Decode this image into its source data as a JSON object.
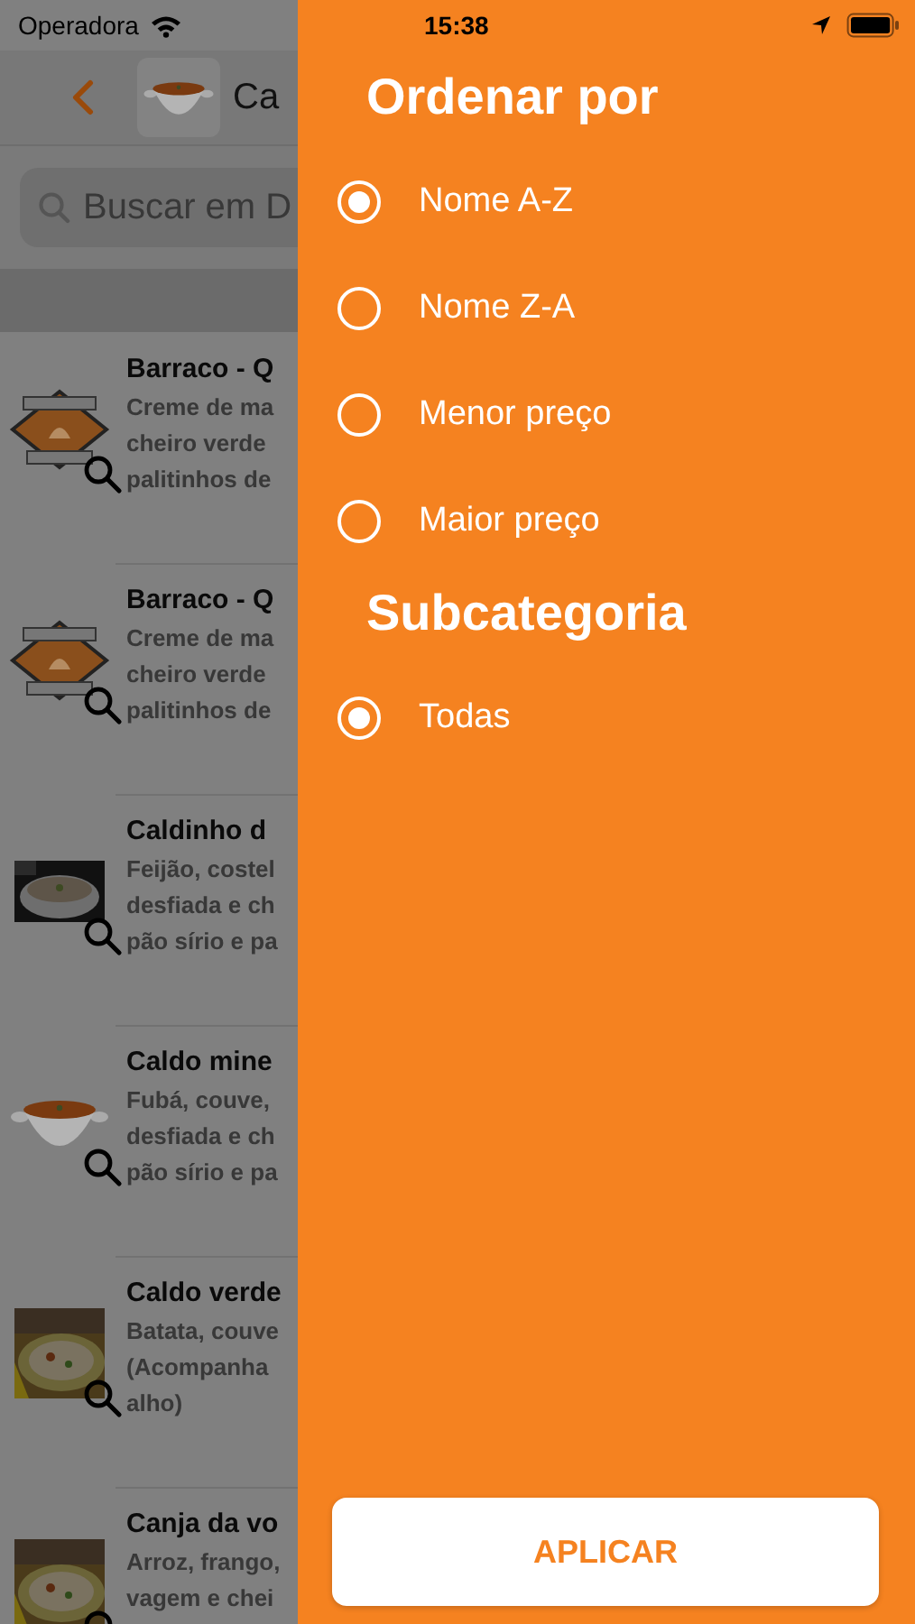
{
  "status_bar": {
    "carrier": "Operadora",
    "time": "15:38"
  },
  "nav_bar": {
    "title": "Ca"
  },
  "search": {
    "placeholder": "Buscar em D"
  },
  "dishes": [
    {
      "name": "Barraco - Q",
      "kind": "logo",
      "description_lines": [
        "Creme de ma",
        "cheiro verde",
        "palitinhos de"
      ]
    },
    {
      "name": "Barraco - Q",
      "kind": "logo",
      "description_lines": [
        "Creme de ma",
        "cheiro verde",
        "palitinhos de"
      ]
    },
    {
      "name": "Caldinho d",
      "kind": "bowl-photo",
      "description_lines": [
        "Feijão, costel",
        "desfiada e ch",
        "pão sírio e pa"
      ]
    },
    {
      "name": "Caldo mine",
      "kind": "tureen",
      "description_lines": [
        "Fubá, couve,",
        "desfiada e ch",
        "pão sírio e pa"
      ]
    },
    {
      "name": "Caldo verde",
      "kind": "soup-photo",
      "description_lines": [
        "Batata, couve",
        "(Acompanha",
        "alho)"
      ]
    },
    {
      "name": "Canja da vo",
      "kind": "soup-photo",
      "description_lines": [
        "Arroz, frango,",
        "vagem e chei"
      ]
    }
  ],
  "drawer": {
    "sort_title": "Ordenar por",
    "sort_options": [
      {
        "label": "Nome A-Z",
        "selected": true
      },
      {
        "label": "Nome Z-A",
        "selected": false
      },
      {
        "label": "Menor preço",
        "selected": false
      },
      {
        "label": "Maior preço",
        "selected": false
      }
    ],
    "subcategory_title": "Subcategoria",
    "subcategory_options": [
      {
        "label": "Todas",
        "selected": true
      }
    ],
    "apply_button": "APLICAR"
  }
}
